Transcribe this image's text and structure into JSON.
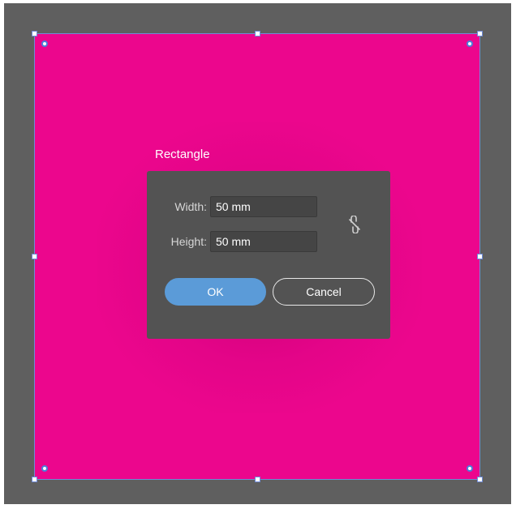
{
  "dialog": {
    "title": "Rectangle",
    "width_label": "Width:",
    "width_value": "50 mm",
    "height_label": "Height:",
    "height_value": "50 mm",
    "constrain_icon": "unlinked-chain-icon",
    "ok_label": "OK",
    "cancel_label": "Cancel"
  },
  "colors": {
    "shape_fill": "#ec068d",
    "canvas_bg": "#5f5f5f",
    "dialog_bg": "#535353",
    "primary_button": "#5b9bd8",
    "selection_outline": "#6f8bd6"
  }
}
